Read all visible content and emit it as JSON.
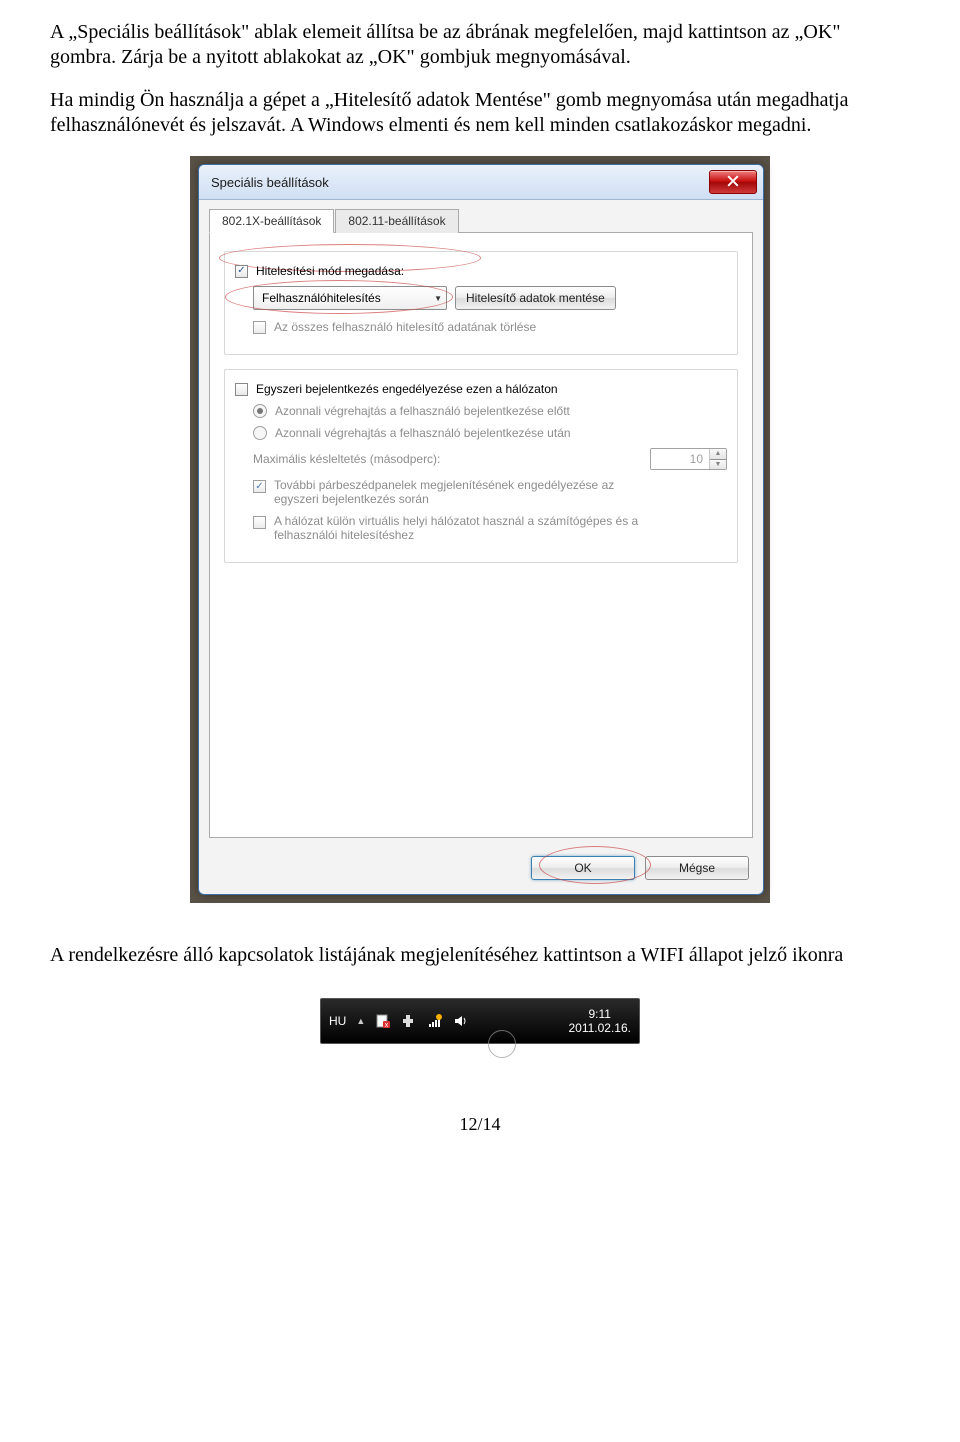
{
  "instructions": {
    "p1": "A „Speciális beállítások\" ablak elemeit állítsa be az ábrának megfelelően, majd kattintson az „OK\" gombra. Zárja be a nyitott ablakokat az „OK\" gombjuk megnyomásával.",
    "p2": "Ha mindig Ön használja a gépet a „Hitelesítő adatok Mentése\" gomb megnyomása után megadhatja felhasználónevét és jelszavát. A Windows elmenti és nem kell minden csatlakozáskor megadni.",
    "p3": "A rendelkezésre álló kapcsolatok listájának megjelenítéséhez kattintson a WIFI állapot jelző ikonra"
  },
  "dialog": {
    "title": "Speciális beállítások",
    "tabs": {
      "t1": "802.1X-beállítások",
      "t2": "802.11-beállítások"
    },
    "group1": {
      "auth_mode_label": "Hitelesítési mód megadása:",
      "auth_mode_value": "Felhasználóhitelesítés",
      "save_creds_btn": "Hitelesítő adatok mentése",
      "delete_all_label": "Az összes felhasználó hitelesítő adatának törlése"
    },
    "group2": {
      "sso_enable": "Egyszeri bejelentkezés engedélyezése ezen a hálózaton",
      "opt_before": "Azonnali végrehajtás a felhasználó bejelentkezése előtt",
      "opt_after": "Azonnali végrehajtás a felhasználó bejelentkezése után",
      "maxdelay_label": "Maximális késleltetés (másodperc):",
      "maxdelay_value": "10",
      "extra_dialogs": "További párbeszédpanelek megjelenítésének engedélyezése az egyszeri bejelentkezés során",
      "vlan_label": "A hálózat külön virtuális helyi hálózatot használ a számítógépes és a felhasználói hitelesítéshez"
    },
    "buttons": {
      "ok": "OK",
      "cancel": "Mégse"
    }
  },
  "taskbar": {
    "lang": "HU",
    "chevron": "▲",
    "time": "9:11",
    "date": "2011.02.16."
  },
  "page_number": "12/14"
}
